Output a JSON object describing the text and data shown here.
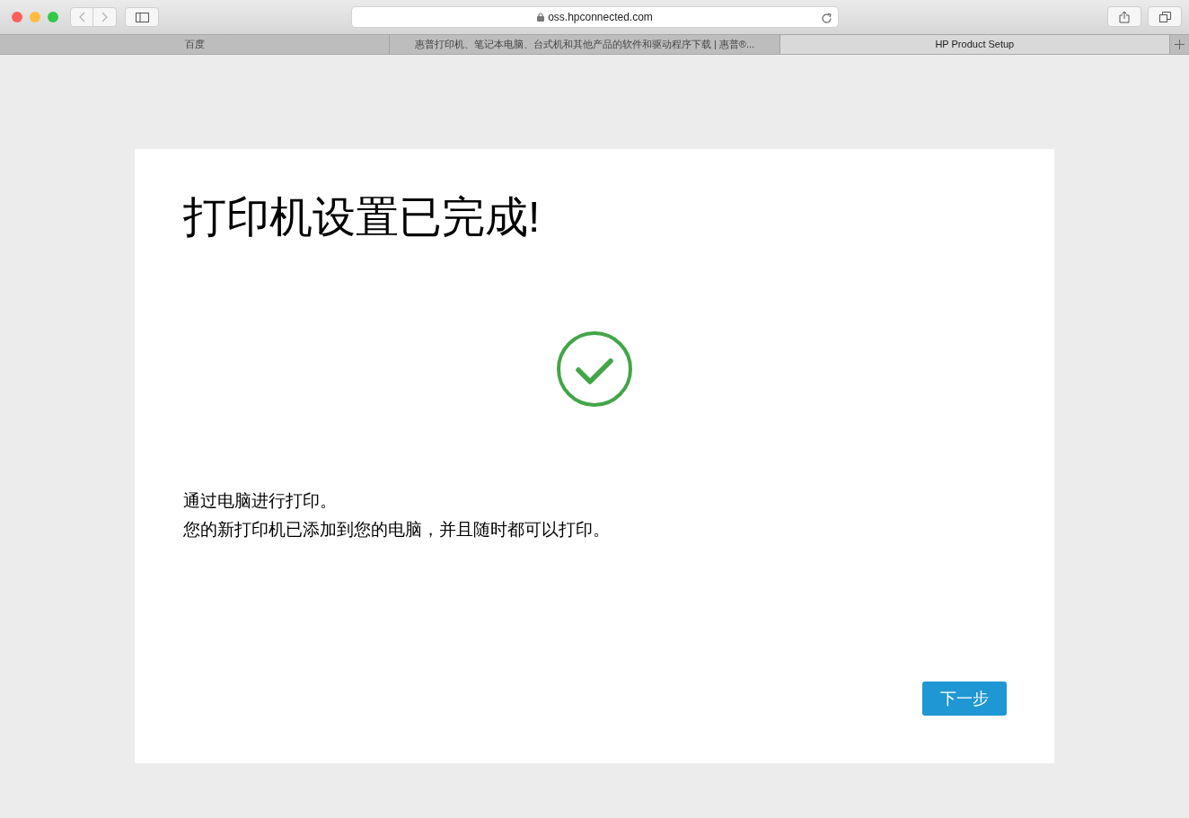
{
  "browser": {
    "address": "oss.hpconnected.com"
  },
  "tabs": [
    {
      "label": "百度",
      "selected": false
    },
    {
      "label": "惠普打印机、笔记本电脑、台式机和其他产品的软件和驱动程序下载 | 惠普®...",
      "selected": false
    },
    {
      "label": "HP Product Setup",
      "selected": true
    }
  ],
  "page": {
    "title": "打印机设置已完成!",
    "lines": [
      "通过电脑进行打印。",
      "您的新打印机已添加到您的电脑，并且随时都可以打印。"
    ],
    "next_button": "下一步"
  }
}
